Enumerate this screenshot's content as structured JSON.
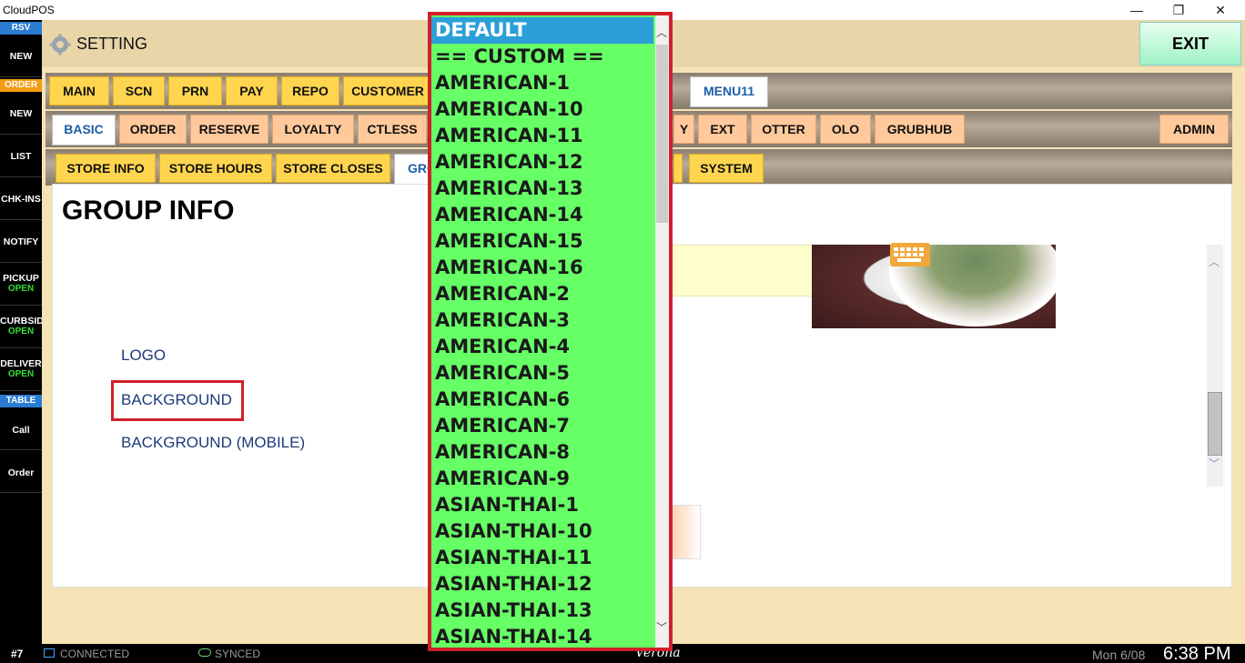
{
  "window": {
    "title": "CloudPOS",
    "min": "—",
    "restore": "❐",
    "close": "✕"
  },
  "sidebar": {
    "sections": [
      {
        "label": "RSV",
        "color": "#2a7bd2"
      },
      {
        "label": "ORDER",
        "color": "#f39c12"
      },
      {
        "label": "TABLE",
        "color": "#2a7bd2"
      }
    ],
    "items": [
      {
        "label": "NEW",
        "sub": ""
      },
      {
        "label": "NEW",
        "sub": ""
      },
      {
        "label": "LIST",
        "sub": ""
      },
      {
        "label": "CHK-INS",
        "sub": ""
      },
      {
        "label": "NOTIFY",
        "sub": ""
      },
      {
        "label": "PICKUP",
        "sub": "OPEN"
      },
      {
        "label": "CURBSID",
        "sub": "OPEN"
      },
      {
        "label": "DELIVER",
        "sub": "OPEN"
      },
      {
        "label": "Call",
        "sub": ""
      },
      {
        "label": "Order",
        "sub": ""
      }
    ]
  },
  "header": {
    "title": "SETTING",
    "exit_label": "EXIT"
  },
  "tabs_row1": [
    "MAIN",
    "SCN",
    "PRN",
    "PAY",
    "REPO",
    "CUSTOMER",
    "MENU11"
  ],
  "tabs_row2": [
    "BASIC",
    "ORDER",
    "RESERVE",
    "LOYALTY",
    "CTLESS",
    "Y",
    "EXT",
    "OTTER",
    "OLO",
    "GRUBHUB",
    "ADMIN"
  ],
  "tabs_row3": [
    "STORE INFO",
    "STORE HOURS",
    "STORE CLOSES",
    "GRO",
    "SYSTEM"
  ],
  "panel": {
    "title": "GROUP INFO",
    "links": {
      "logo": "LOGO",
      "background": "BACKGROUND",
      "background_mobile": "BACKGROUND (MOBILE)"
    }
  },
  "dropdown": {
    "selected": "DEFAULT",
    "options": [
      "DEFAULT",
      "== CUSTOM ==",
      "AMERICAN-1",
      "AMERICAN-10",
      "AMERICAN-11",
      "AMERICAN-12",
      "AMERICAN-13",
      "AMERICAN-14",
      "AMERICAN-15",
      "AMERICAN-16",
      "AMERICAN-2",
      "AMERICAN-3",
      "AMERICAN-4",
      "AMERICAN-5",
      "AMERICAN-6",
      "AMERICAN-7",
      "AMERICAN-8",
      "AMERICAN-9",
      "ASIAN-THAI-1",
      "ASIAN-THAI-10",
      "ASIAN-THAI-11",
      "ASIAN-THAI-12",
      "ASIAN-THAI-13",
      "ASIAN-THAI-14"
    ]
  },
  "statusbar": {
    "station": "#7",
    "connection": "CONNECTED",
    "sync": "SYNCED",
    "store": "Verona",
    "date": "Mon 6/08",
    "time": "6:38 PM"
  },
  "colors": {
    "accent_tab": "#ffd54f",
    "peach_tab": "#ffc99b",
    "dropdown_bg": "#66ff66",
    "selected_bg": "#2a9fd8",
    "highlight_border": "#d0202a"
  }
}
